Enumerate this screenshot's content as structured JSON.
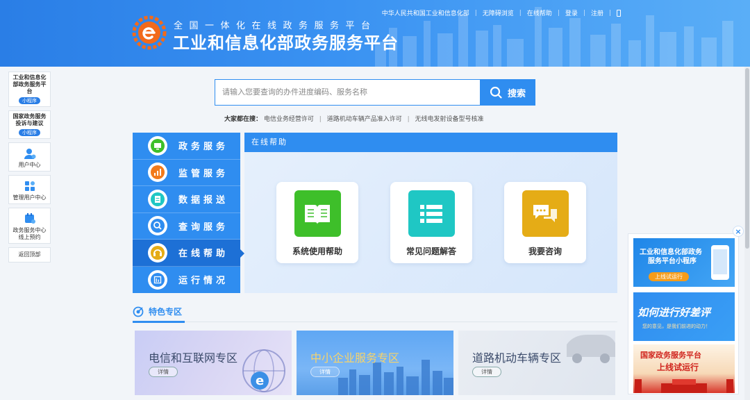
{
  "header": {
    "slogan": "全国一体化在线政务服务平台",
    "title": "工业和信息化部政务服务平台",
    "links": [
      "中华人民共和国工业和信息化部",
      "无障碍浏览",
      "在线帮助",
      "登录",
      "注册"
    ]
  },
  "sidebar": {
    "items": [
      {
        "title": "工业和信息化部政务服务平台",
        "badge": "小程序"
      },
      {
        "title": "国家政务服务投诉与建议",
        "badge": "小程序"
      },
      {
        "label": "用户中心",
        "icon": "user-icon"
      },
      {
        "label": "管理用户中心",
        "icon": "grid-icon"
      },
      {
        "label": "政务服务中心线上预约",
        "icon": "calendar-icon"
      },
      {
        "label": "返回顶部"
      }
    ]
  },
  "search": {
    "placeholder": "请输入您要查询的办件进度编码、服务名称",
    "button": "搜索",
    "hot_label": "大家都在搜：",
    "hot_items": [
      "电信业务经营许可",
      "道路机动车辆产品准入许可",
      "无线电发射设备型号核准"
    ]
  },
  "nav": {
    "items": [
      "政务服务",
      "监管服务",
      "数据报送",
      "查询服务",
      "在线帮助",
      "运行情况"
    ],
    "active_index": 4
  },
  "panel": {
    "title": "在线帮助",
    "cards": [
      {
        "label": "系统使用帮助",
        "color": "#3ebf2a",
        "icon": "book-icon"
      },
      {
        "label": "常见问题解答",
        "color": "#1fc7c4",
        "icon": "list-icon"
      },
      {
        "label": "我要咨询",
        "color": "#e5ac16",
        "icon": "chat-icon"
      }
    ]
  },
  "zone": {
    "title": "特色专区",
    "cards": [
      {
        "title": "电信和互联网专区",
        "button": "详情"
      },
      {
        "title": "中小企业服务专区",
        "button": "详情"
      },
      {
        "title": "道路机动车辆专区",
        "button": "详情"
      }
    ]
  },
  "right_banners": [
    {
      "line1": "工业和信息化部政务",
      "line2": "服务平台小程序",
      "tag": "上线试运行"
    },
    {
      "line1": "如何进行好差评",
      "line2": "您的意见，是我们前进的动力！"
    },
    {
      "line1": "国家政务服务平台",
      "line2": "上线试运行"
    }
  ],
  "close_symbol": "×"
}
